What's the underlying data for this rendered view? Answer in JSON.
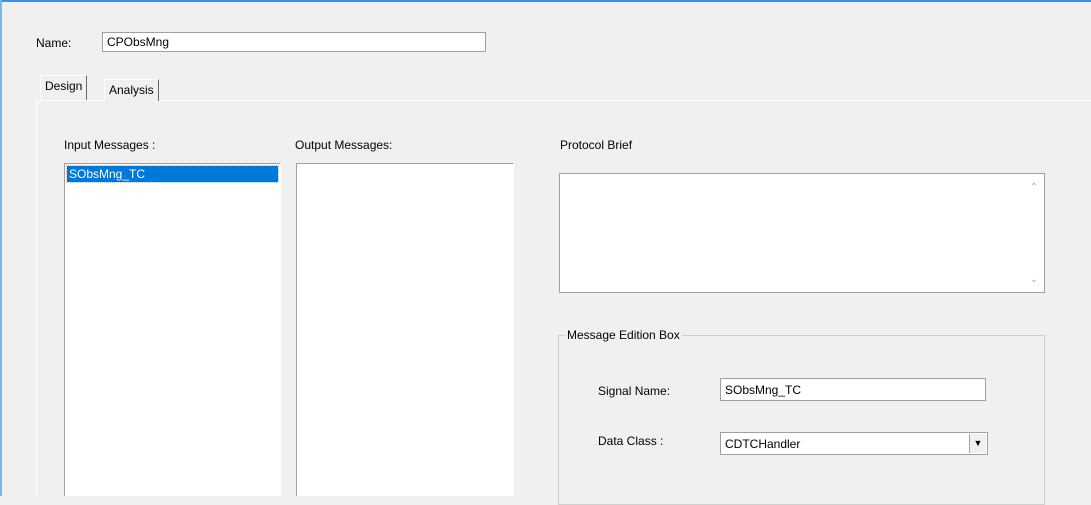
{
  "name_field": {
    "label": "Name:",
    "value": "CPObsMng"
  },
  "tabs": [
    {
      "label": "Design",
      "active": true
    },
    {
      "label": "Analysis",
      "active": false
    }
  ],
  "input_messages": {
    "label": "Input Messages :",
    "items": [
      "SObsMng_TC"
    ],
    "selected_index": 0
  },
  "output_messages": {
    "label": "Output Messages:",
    "items": []
  },
  "protocol_brief": {
    "label": "Protocol Brief",
    "value": ""
  },
  "message_edition": {
    "title": "Message Edition Box",
    "signal_name": {
      "label": "Signal Name:",
      "value": "SObsMng_TC"
    },
    "data_class": {
      "label": "Data Class :",
      "value": "CDTCHandler"
    }
  },
  "colors": {
    "accent": "#0078d7",
    "window_border": "#3b8ee0",
    "background": "#f0f0f0"
  },
  "icons": {
    "scroll_up": "chevron-up-icon",
    "scroll_down": "chevron-down-icon",
    "dropdown": "dropdown-arrow-icon"
  }
}
